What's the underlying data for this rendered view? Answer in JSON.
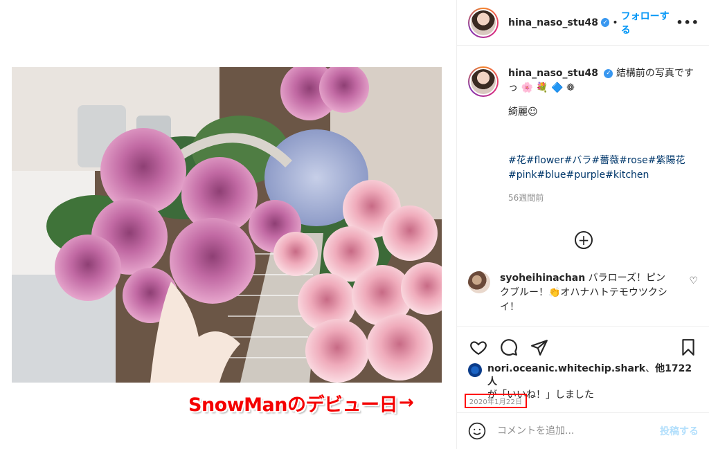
{
  "post": {
    "username": "hina_naso_stu48",
    "separator": "•",
    "follow_label": "フォローする",
    "more_label": "•••"
  },
  "caption": {
    "username": "hina_naso_stu48",
    "line1": "結構前の写真です",
    "line1_cont": "っ 🌸 💐 🔷 ❁",
    "line2": "綺麗☺",
    "hashtags": "#花#flower#バラ#薔薇#rose#紫陽花#pink#blue#purple#kitchen",
    "time_ago": "56週間前",
    "load_more": "+"
  },
  "comment": {
    "username": "syoheihinachan",
    "text": "バラローズ！ピンクブルー！👏オハナハトテモウツクシイ！",
    "like_icon": "♡"
  },
  "likes": {
    "username": "nori.oceanic.whitechip.shark",
    "mid": "、",
    "others": "他1722人",
    "suffix": "が「いいね！」しました"
  },
  "date": "2020年1月22日",
  "annotation": {
    "text": "SnowManのデビュー日",
    "arrow": "→",
    "color": "#f40000"
  },
  "add_comment": {
    "placeholder": "コメントを追加...",
    "post_label": "投稿する"
  },
  "colors": {
    "link": "#0095f6",
    "hashtag": "#00376b",
    "muted": "#8e8e8e",
    "highlight_box": "#ff0000"
  }
}
